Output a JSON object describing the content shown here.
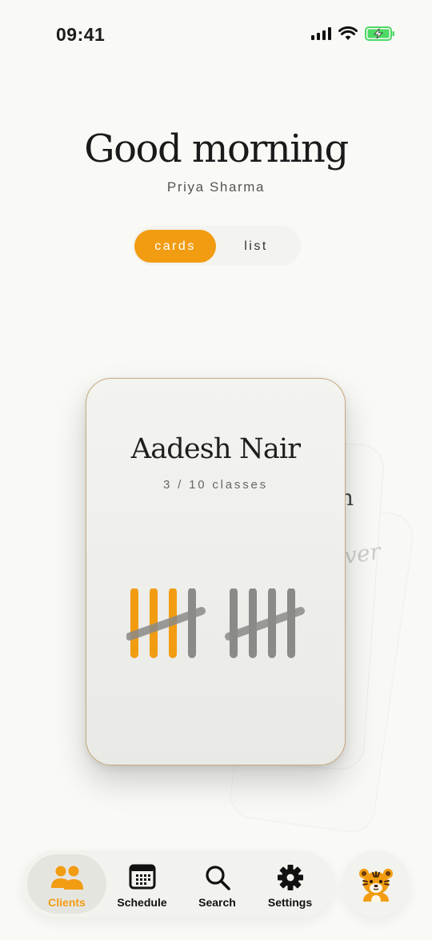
{
  "status_bar": {
    "time": "09:41"
  },
  "header": {
    "greeting": "Good morning",
    "user_name": "Priya Sharma"
  },
  "view_toggle": {
    "options": [
      "cards",
      "list"
    ],
    "selected": "cards"
  },
  "card_stack": {
    "top_card": {
      "client_name": "Aadesh Nair",
      "progress_label": "3 / 10 classes",
      "classes_done": 3,
      "classes_total": 10
    },
    "peek_texts": [
      "n",
      "ver"
    ]
  },
  "tab_bar": {
    "items": [
      {
        "label": "Clients",
        "icon": "people-icon",
        "active": true
      },
      {
        "label": "Schedule",
        "icon": "calendar-icon",
        "active": false
      },
      {
        "label": "Search",
        "icon": "magnifier-icon",
        "active": false
      },
      {
        "label": "Settings",
        "icon": "gear-icon",
        "active": false
      }
    ]
  },
  "profile": {
    "icon": "tiger-avatar-icon"
  },
  "colors": {
    "accent": "#f29c12",
    "background": "#f9f9f6",
    "card_border": "#c4a97e",
    "tally_inactive": "#8a8a88"
  }
}
